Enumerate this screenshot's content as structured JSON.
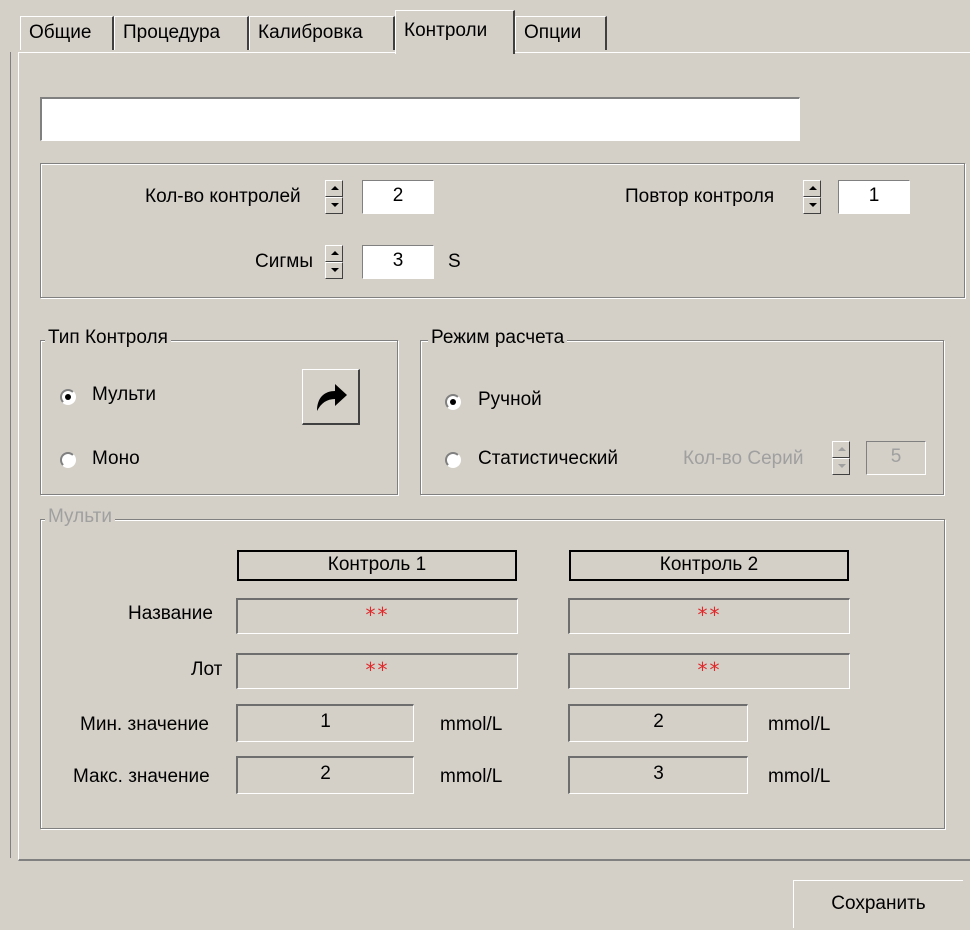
{
  "tabs": [
    "Общие",
    "Процедура",
    "Калибровка",
    "Контроли",
    "Опции"
  ],
  "active_tab": "Контроли",
  "name_field": {
    "value": ""
  },
  "settings": {
    "count_label": "Кол-во контролей",
    "count_value": "2",
    "repeat_label": "Повтор контроля",
    "repeat_value": "1",
    "sigma_label": "Сигмы",
    "sigma_value": "3",
    "sigma_unit": "S"
  },
  "control_type": {
    "legend": "Тип Контроля",
    "options": [
      {
        "label": "Мульти",
        "selected": true
      },
      {
        "label": "Моно",
        "selected": false
      }
    ],
    "action_icon": "curved-arrow-icon"
  },
  "calc_mode": {
    "legend": "Режим расчета",
    "options": [
      {
        "label": "Ручной",
        "selected": true
      },
      {
        "label": "Статистический",
        "selected": false
      }
    ],
    "series_label": "Кол-во Серий",
    "series_value": "5"
  },
  "multi": {
    "legend": "Мульти",
    "columns": [
      "Контроль 1",
      "Контроль 2"
    ],
    "row_labels": {
      "name": "Название",
      "lot": "Лот",
      "min": "Мин. значение",
      "max": "Макс. значение"
    },
    "controls": [
      {
        "name": "**",
        "lot": "**",
        "min": "1",
        "max": "2",
        "unit": "mmol/L"
      },
      {
        "name": "**",
        "lot": "**",
        "min": "2",
        "max": "3",
        "unit": "mmol/L"
      }
    ]
  },
  "save_button": "Сохранить",
  "colors": {
    "stars": "#e0282a",
    "face": "#d4d0c8"
  }
}
